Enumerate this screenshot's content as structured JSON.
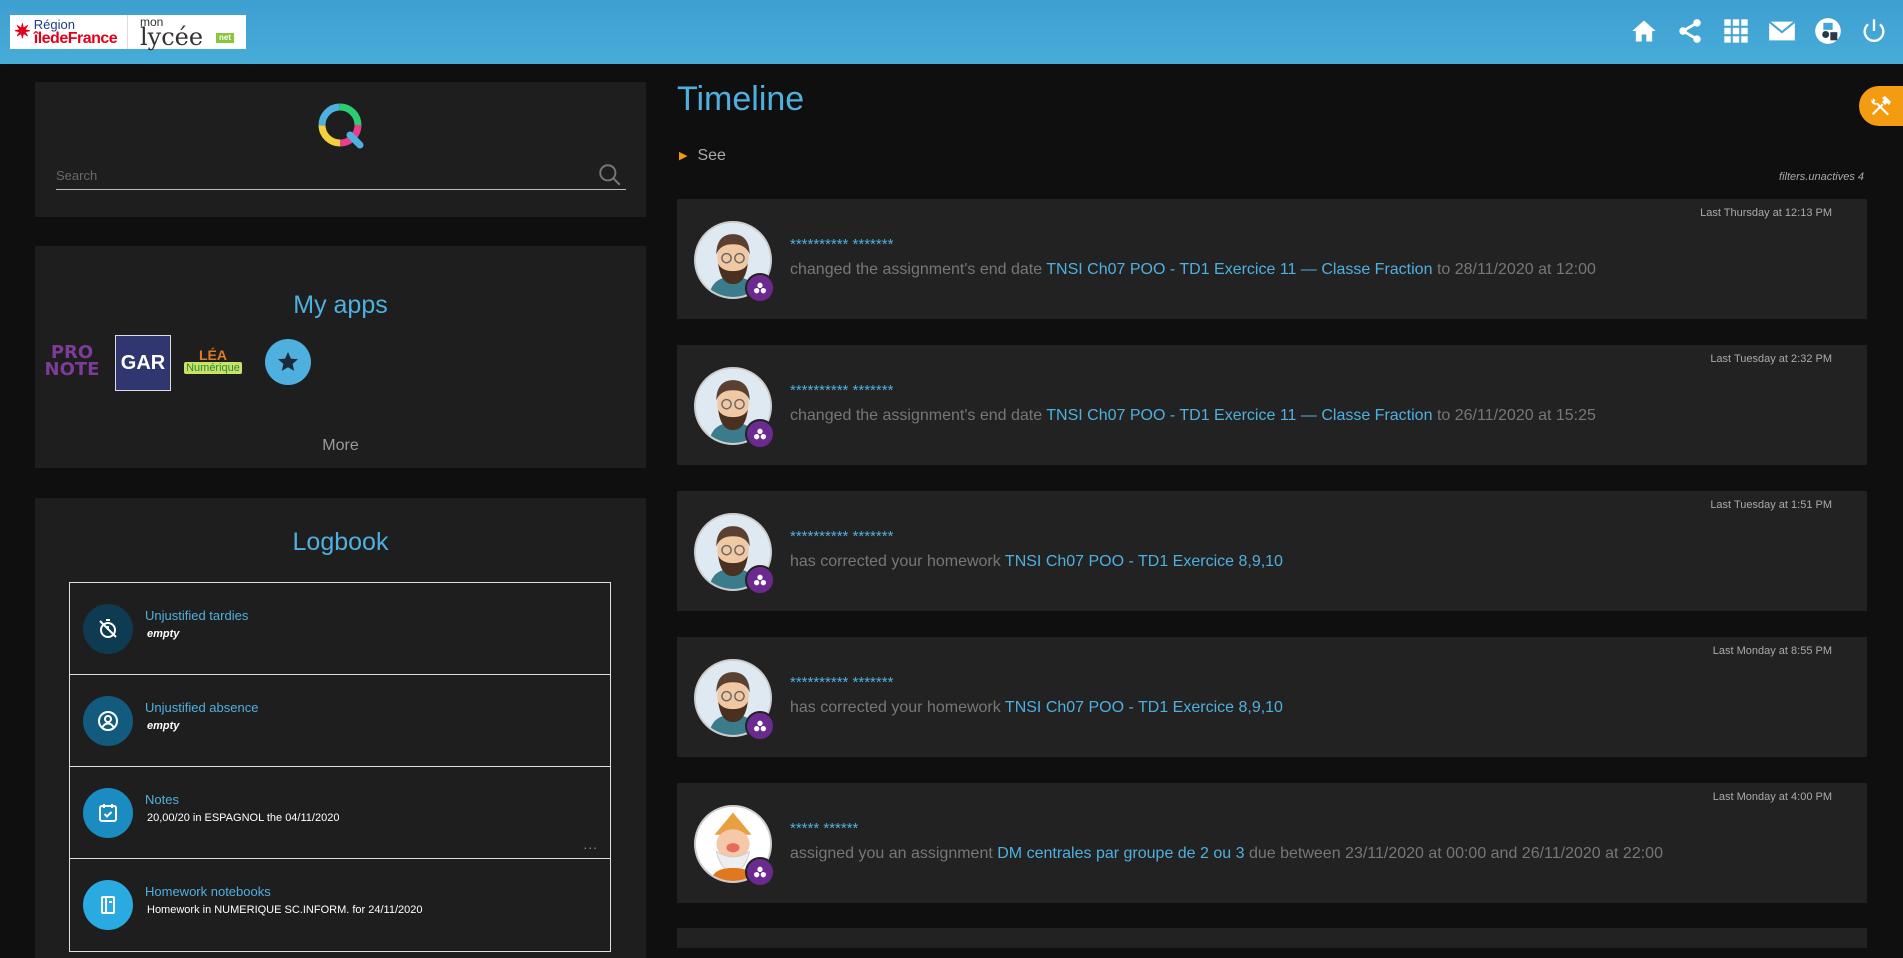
{
  "header": {
    "logo_region_line1": "Région",
    "logo_region_line2": "îledeFrance",
    "logo_lycee_line1": "mon",
    "logo_lycee_line2": "lycée",
    "logo_lycee_badge": "net",
    "icons": [
      "home-icon",
      "share-icon",
      "apps-grid-icon",
      "mail-icon",
      "user-account-icon",
      "power-icon"
    ]
  },
  "search": {
    "placeholder": "Search"
  },
  "apps": {
    "title": "My apps",
    "items": [
      {
        "name": "PRONOTE",
        "line1": "PRO",
        "line2": "NOTE"
      },
      {
        "name": "GAR",
        "label": "GAR"
      },
      {
        "name": "LÉA Numérique",
        "line1": "LÉA",
        "line2": "Numérique"
      },
      {
        "name": "favorites",
        "icon": "star-icon"
      }
    ],
    "more_label": "More"
  },
  "logbook": {
    "title": "Logbook",
    "rows": [
      {
        "title": "Unjustified tardies",
        "value": "empty",
        "color": "#0e3a52"
      },
      {
        "title": "Unjustified absence",
        "value": "empty",
        "color": "#125a7e"
      },
      {
        "title": "Notes",
        "value": "20,00/20 in ESPAGNOL the 04/11/2020",
        "color": "#1a8cc2"
      },
      {
        "title": "Homework notebooks",
        "value": "Homework in NUMERIQUE SC.INFORM. for 24/11/2020",
        "color": "#29abe2"
      }
    ],
    "dots": "..."
  },
  "timeline": {
    "title": "Timeline",
    "see_label": "See",
    "filters_note": "filters.unactives 4",
    "cards": [
      {
        "time": "Last Thursday at 12:13 PM",
        "author": "********** *******",
        "text_before": "changed the assignment's end date",
        "link": "TNSI Ch07 POO - TD1 Exercice 11 — Classe Fraction",
        "text_after": "to 28/11/2020 at 12:00"
      },
      {
        "time": "Last Tuesday at 2:32 PM",
        "author": "********** *******",
        "text_before": "changed the assignment's end date",
        "link": "TNSI Ch07 POO - TD1 Exercice 11 — Classe Fraction",
        "text_after": "to 26/11/2020 at 15:25"
      },
      {
        "time": "Last Tuesday at 1:51 PM",
        "author": "********** *******",
        "text_before": "has corrected your homework",
        "link": "TNSI Ch07 POO - TD1 Exercice 8,9,10",
        "text_after": ""
      },
      {
        "time": "Last Monday at 8:55 PM",
        "author": "********** *******",
        "text_before": "has corrected your homework",
        "link": "TNSI Ch07 POO - TD1 Exercice 8,9,10",
        "text_after": ""
      },
      {
        "time": "Last Monday at 4:00 PM",
        "author": "***** ******",
        "text_before": "assigned you an assignment",
        "link": "DM centrales par groupe de 2 ou 3",
        "text_after": "due between 23/11/2020 at 00:00 and 26/11/2020 at 22:00"
      }
    ]
  },
  "colors": {
    "accent": "#4fb0e0",
    "header": "#44a6d6",
    "fab": "#f39c12",
    "badge": "#6a2a8f"
  }
}
